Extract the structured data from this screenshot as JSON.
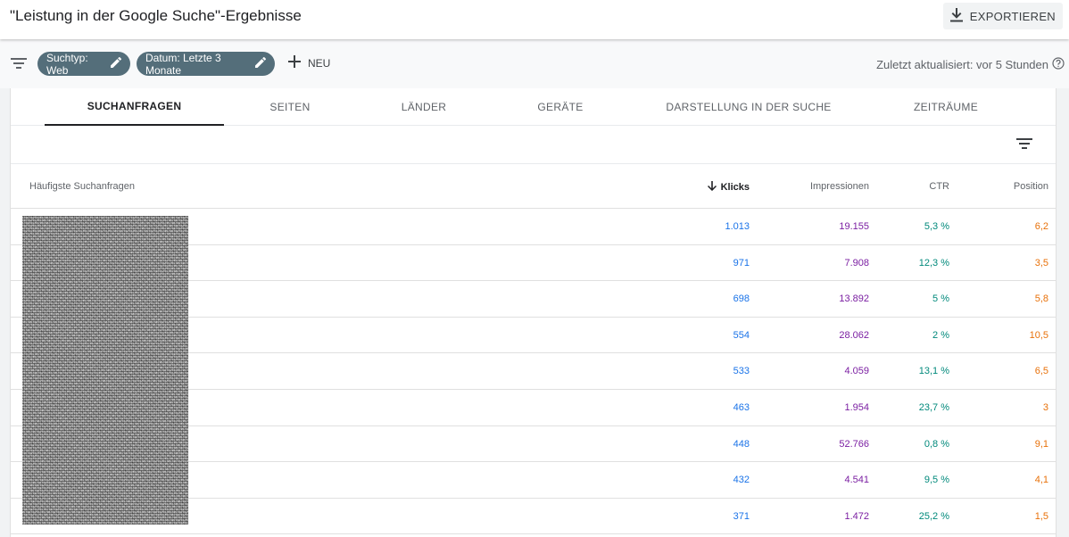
{
  "header": {
    "title": "\"Leistung in der Google Suche\"-Ergebnisse",
    "export_label": "EXPORTIEREN"
  },
  "filterbar": {
    "chips": [
      {
        "label": "Suchtyp: Web"
      },
      {
        "label": "Datum: Letzte 3 Monate"
      }
    ],
    "new_label": "NEU",
    "updated_text": "Zuletzt aktualisiert: vor 5 Stunden"
  },
  "tabs": [
    {
      "label": "SUCHANFRAGEN",
      "active": true
    },
    {
      "label": "SEITEN"
    },
    {
      "label": "LÄNDER"
    },
    {
      "label": "GERÄTE"
    },
    {
      "label": "DARSTELLUNG IN DER SUCHE"
    },
    {
      "label": "ZEITRÄUME"
    }
  ],
  "table": {
    "columns": {
      "query": "Häufigste Suchanfragen",
      "clicks": "Klicks",
      "impressions": "Impressionen",
      "ctr": "CTR",
      "position": "Position"
    },
    "sort_column": "clicks",
    "rows": [
      {
        "clicks": "1.013",
        "impressions": "19.155",
        "ctr": "5,3 %",
        "position": "6,2"
      },
      {
        "clicks": "971",
        "impressions": "7.908",
        "ctr": "12,3 %",
        "position": "3,5"
      },
      {
        "clicks": "698",
        "impressions": "13.892",
        "ctr": "5 %",
        "position": "5,8"
      },
      {
        "clicks": "554",
        "impressions": "28.062",
        "ctr": "2 %",
        "position": "10,5"
      },
      {
        "clicks": "533",
        "impressions": "4.059",
        "ctr": "13,1 %",
        "position": "6,5"
      },
      {
        "clicks": "463",
        "impressions": "1.954",
        "ctr": "23,7 %",
        "position": "3"
      },
      {
        "clicks": "448",
        "impressions": "52.766",
        "ctr": "0,8 %",
        "position": "9,1"
      },
      {
        "clicks": "432",
        "impressions": "4.541",
        "ctr": "9,5 %",
        "position": "4,1"
      },
      {
        "clicks": "371",
        "impressions": "1.472",
        "ctr": "25,2 %",
        "position": "1,5"
      }
    ]
  },
  "colors": {
    "clicks": "#1a73e8",
    "impressions": "#7b1fa2",
    "ctr": "#00897b",
    "position": "#e8710a",
    "chip": "#546e7a"
  },
  "icons": {
    "export": "download-icon",
    "filter": "filter-list-icon",
    "edit": "pencil-icon",
    "add": "plus-icon",
    "help": "help-circle-icon",
    "sort": "arrow-down-icon"
  }
}
